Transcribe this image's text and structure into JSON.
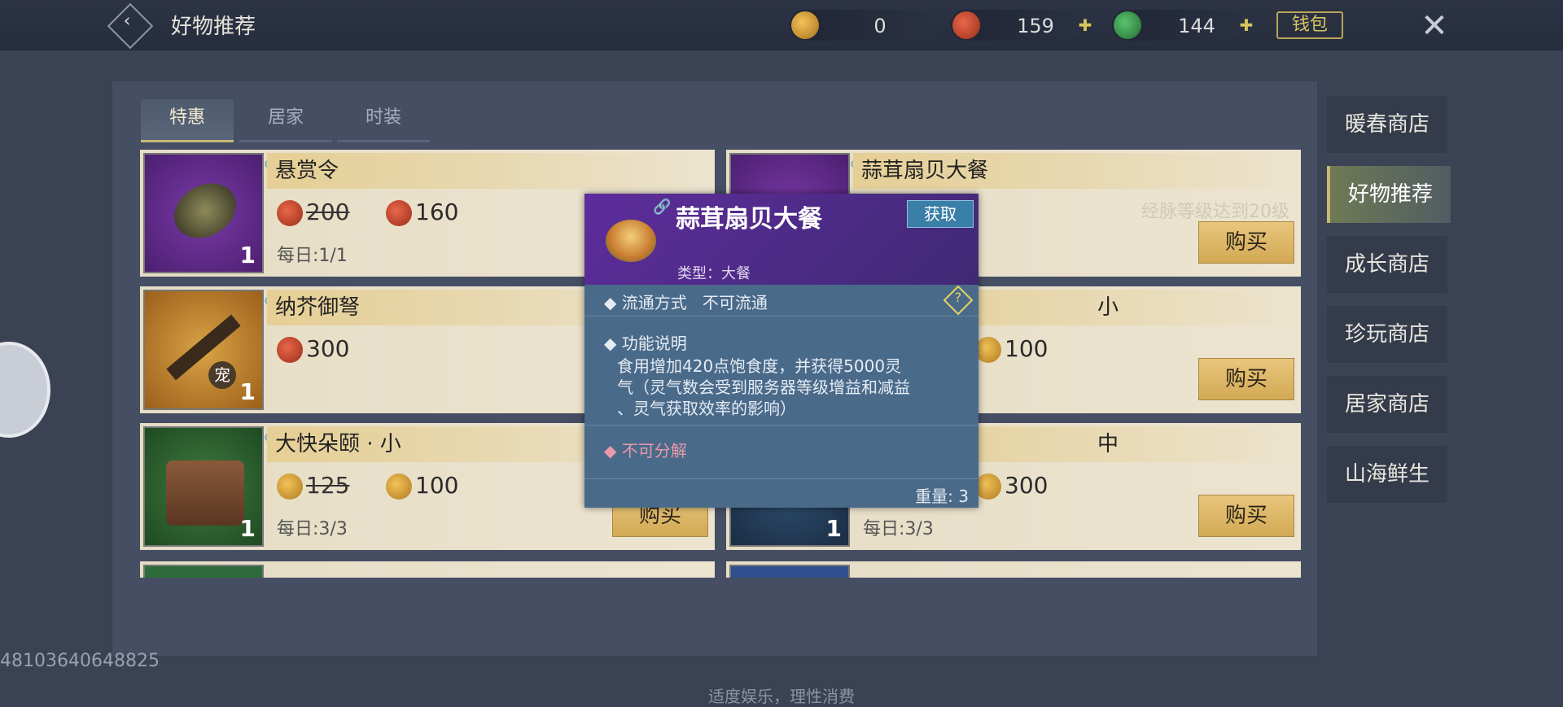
{
  "header": {
    "title": "好物推荐",
    "currencies": [
      {
        "icon": "gold-coin-icon",
        "value": "0"
      },
      {
        "icon": "red-coin-icon",
        "value": "159"
      },
      {
        "icon": "jade-coin-icon",
        "value": "144"
      }
    ],
    "wallet_label": "钱包"
  },
  "tabs": [
    "特惠",
    "居家",
    "时装"
  ],
  "sidebar": [
    "暖春商店",
    "好物推荐",
    "成长商店",
    "珍玩商店",
    "居家商店",
    "山海鲜生"
  ],
  "items": [
    {
      "name": "悬赏令",
      "qty": "1",
      "old_price": "200",
      "price": "160",
      "daily": "每日:1/1"
    },
    {
      "name": "蒜茸扇贝大餐",
      "condition": "经脉等级达到20级",
      "buy": "购买"
    },
    {
      "name": "纳芥御弩",
      "qty": "1",
      "badge": "宠",
      "price": "300"
    },
    {
      "name_suffix": "小",
      "price": "100",
      "buy": "购买"
    },
    {
      "name": "大快朵颐 · 小",
      "qty": "1",
      "old_price": "125",
      "price": "100",
      "daily": "每日:3/3",
      "buy": "购买"
    },
    {
      "name_suffix": "中",
      "qty": "1",
      "price": "300",
      "daily": "每日:3/3",
      "buy": "购买"
    }
  ],
  "popup": {
    "title": "蒜茸扇贝大餐",
    "get_label": "获取",
    "type": "类型：大餐",
    "circulation_label": "流通方式",
    "circulation_value": "不可流通",
    "function_label": "功能说明",
    "description_1": "食用增加420点饱食度，并获得5000灵",
    "description_2": "气（灵气数会受到服务器等级增益和减益",
    "description_3": "、灵气获取效率的影响）",
    "decompose": "不可分解",
    "weight": "重量: 3"
  },
  "footer": {
    "note": "适度娱乐，理性消费",
    "uid": "48103640648825"
  },
  "colors": {
    "accent_gold": "#c8b77a",
    "popup_purple": "#5e2c9c",
    "popup_blue": "#4a6a8a"
  }
}
